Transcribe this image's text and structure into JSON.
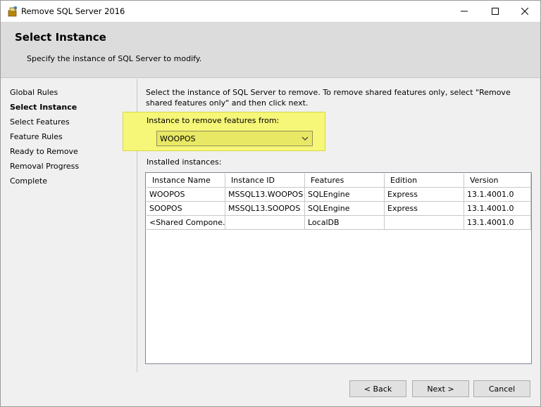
{
  "window": {
    "title": "Remove SQL Server 2016"
  },
  "header": {
    "title": "Select Instance",
    "subtitle": "Specify the instance of SQL Server to modify."
  },
  "nav": {
    "items": [
      {
        "label": "Global Rules",
        "active": false
      },
      {
        "label": "Select Instance",
        "active": true
      },
      {
        "label": "Select Features",
        "active": false
      },
      {
        "label": "Feature Rules",
        "active": false
      },
      {
        "label": "Ready to Remove",
        "active": false
      },
      {
        "label": "Removal Progress",
        "active": false
      },
      {
        "label": "Complete",
        "active": false
      }
    ]
  },
  "content": {
    "instructions": "Select the instance of SQL Server to remove. To remove shared features only, select \"Remove shared features only\" and then click next.",
    "instance_label": "Instance to remove features from:",
    "instance_selected": "WOOPOS",
    "installed_label": "Installed instances:",
    "columns": [
      "Instance Name",
      "Instance ID",
      "Features",
      "Edition",
      "Version"
    ],
    "rows": [
      [
        "WOOPOS",
        "MSSQL13.WOOPOS",
        "SQLEngine",
        "Express",
        "13.1.4001.0"
      ],
      [
        "SOOPOS",
        "MSSQL13.SOOPOS",
        "SQLEngine",
        "Express",
        "13.1.4001.0"
      ],
      [
        "<Shared Compone...",
        "",
        "LocalDB",
        "",
        "13.1.4001.0"
      ]
    ]
  },
  "buttons": {
    "back": "< Back",
    "next": "Next >",
    "cancel": "Cancel"
  },
  "colors": {
    "highlight": "#f6f678",
    "header_bg": "#dcdcdc"
  }
}
